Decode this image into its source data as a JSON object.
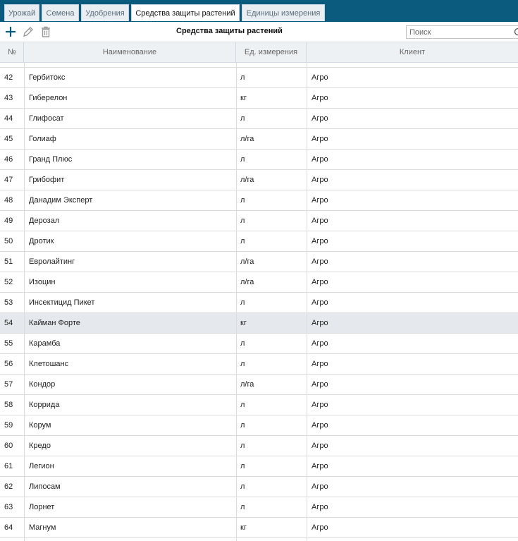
{
  "tabs": [
    {
      "label": "Урожай",
      "active": false
    },
    {
      "label": "Семена",
      "active": false
    },
    {
      "label": "Удобрения",
      "active": false
    },
    {
      "label": "Средства защиты растений",
      "active": true
    },
    {
      "label": "Единицы измерения",
      "active": false
    }
  ],
  "toolbar": {
    "title": "Средства защиты растений",
    "add_icon": "plus-icon",
    "edit_icon": "pencil-icon",
    "delete_icon": "trash-icon"
  },
  "search": {
    "placeholder": "Поиск",
    "value": ""
  },
  "table": {
    "columns": [
      "№",
      "Наименование",
      "Ед. измерения",
      "Клиент"
    ],
    "selected_index": 12,
    "rows": [
      {
        "num": "42",
        "name": "Гербитокс",
        "unit": "л",
        "client": "Агро"
      },
      {
        "num": "43",
        "name": "Гиберелон",
        "unit": "кг",
        "client": "Агро"
      },
      {
        "num": "44",
        "name": "Глифосат",
        "unit": "л",
        "client": "Агро"
      },
      {
        "num": "45",
        "name": "Голиаф",
        "unit": "л/га",
        "client": "Агро"
      },
      {
        "num": "46",
        "name": "Гранд Плюс",
        "unit": "л",
        "client": "Агро"
      },
      {
        "num": "47",
        "name": "Грибофит",
        "unit": "л/га",
        "client": "Агро"
      },
      {
        "num": "48",
        "name": "Данадим Эксперт",
        "unit": "л",
        "client": "Агро"
      },
      {
        "num": "49",
        "name": "Дерозал",
        "unit": "л",
        "client": "Агро"
      },
      {
        "num": "50",
        "name": "Дротик",
        "unit": "л",
        "client": "Агро"
      },
      {
        "num": "51",
        "name": "Евролайтинг",
        "unit": "л/га",
        "client": "Агро"
      },
      {
        "num": "52",
        "name": "Изоцин",
        "unit": "л/га",
        "client": "Агро"
      },
      {
        "num": "53",
        "name": "Инсектицид Пикет",
        "unit": "л",
        "client": "Агро"
      },
      {
        "num": "54",
        "name": "Кайман Форте",
        "unit": "кг",
        "client": "Агро"
      },
      {
        "num": "55",
        "name": "Карамба",
        "unit": "л",
        "client": "Агро"
      },
      {
        "num": "56",
        "name": "Клетошанс",
        "unit": "л",
        "client": "Агро"
      },
      {
        "num": "57",
        "name": "Кондор",
        "unit": "л/га",
        "client": "Агро"
      },
      {
        "num": "58",
        "name": "Коррида",
        "unit": "л",
        "client": "Агро"
      },
      {
        "num": "59",
        "name": "Корум",
        "unit": "л",
        "client": "Агро"
      },
      {
        "num": "60",
        "name": "Кредо",
        "unit": "л",
        "client": "Агро"
      },
      {
        "num": "61",
        "name": "Легион",
        "unit": "л",
        "client": "Агро"
      },
      {
        "num": "62",
        "name": "Липосам",
        "unit": "л",
        "client": "Агро"
      },
      {
        "num": "63",
        "name": "Лорнет",
        "unit": "л",
        "client": "Агро"
      },
      {
        "num": "64",
        "name": "Магнум",
        "unit": "кг",
        "client": "Агро"
      }
    ]
  },
  "colors": {
    "tabbar_bg": "#0b5b7e",
    "header_bg": "#eef1f4",
    "selected_row_bg": "#e5e9ed",
    "icon_blue": "#0b5b7e",
    "icon_gray": "#9a9a9a"
  }
}
